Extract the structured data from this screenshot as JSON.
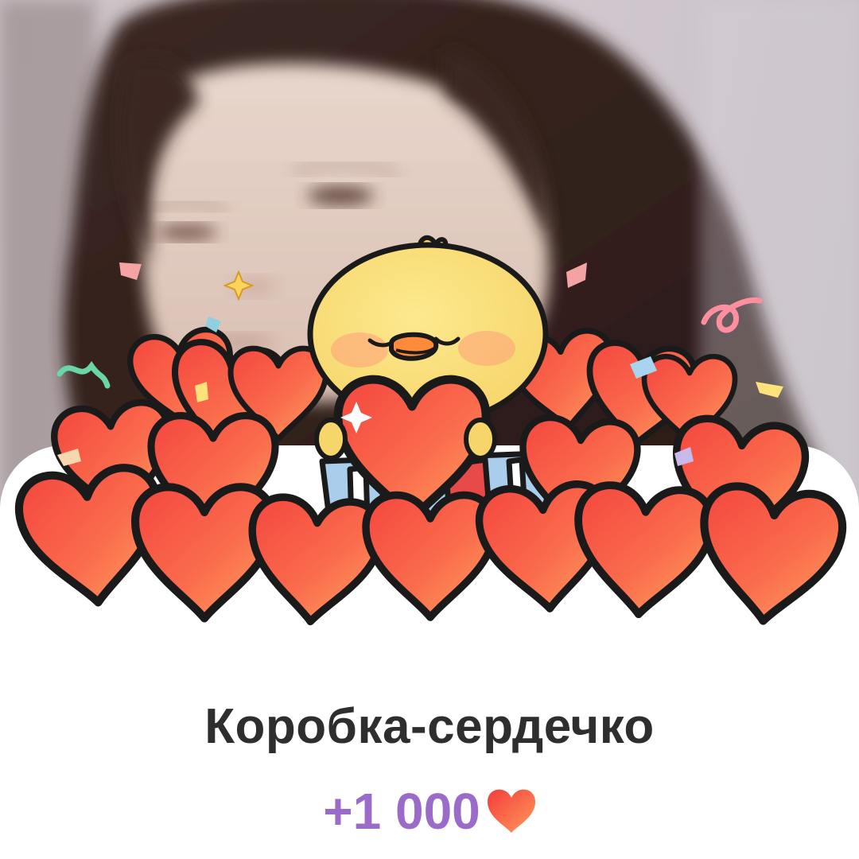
{
  "gift": {
    "title": "Коробка-сердечко",
    "reward": "+1 000",
    "reward_icon": "heart-icon",
    "illustration": "chick-holding-heart-in-box-with-hearts-and-confetti"
  },
  "colors": {
    "title": "#2e2e2e",
    "reward": "#9b6bc9",
    "heart_light": "#ff9a5a",
    "heart_dark": "#f43c3c",
    "chick": "#fae07a",
    "box": "#a9cdea"
  }
}
